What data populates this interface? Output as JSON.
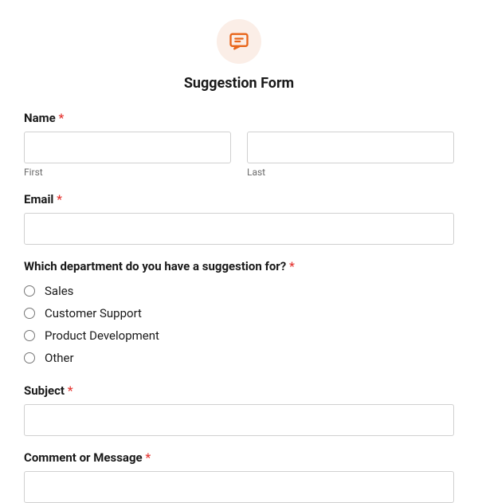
{
  "header": {
    "title": "Suggestion Form"
  },
  "fields": {
    "name": {
      "label": "Name",
      "sublabels": {
        "first": "First",
        "last": "Last"
      }
    },
    "email": {
      "label": "Email"
    },
    "department": {
      "label": "Which department do you have a suggestion for?",
      "options": [
        "Sales",
        "Customer Support",
        "Product Development",
        "Other"
      ]
    },
    "subject": {
      "label": "Subject"
    },
    "message": {
      "label": "Comment or Message"
    }
  },
  "required_marker": "*"
}
